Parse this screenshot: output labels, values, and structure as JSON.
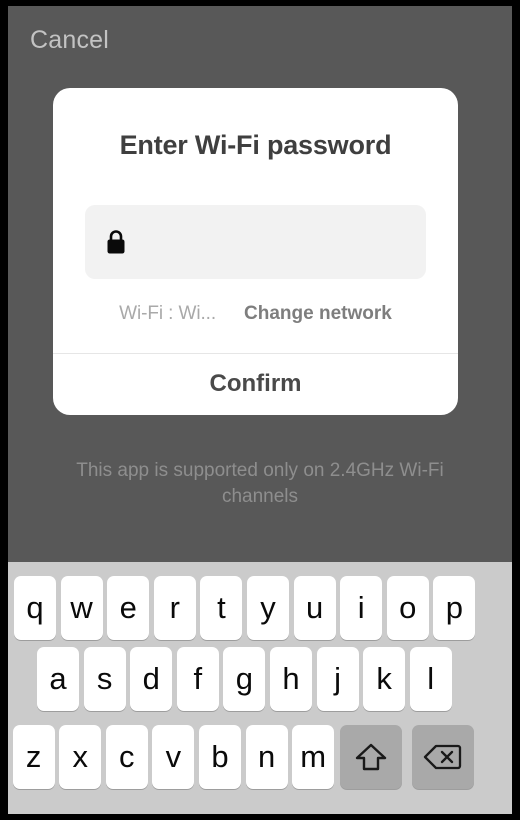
{
  "overlay": {
    "cancel_label": "Cancel"
  },
  "dialog": {
    "title": "Enter Wi-Fi password",
    "password_field": {
      "value": "",
      "placeholder": "",
      "icon": "lock-icon"
    },
    "network_label": "Wi-Fi : Wi...",
    "change_network_label": "Change network",
    "confirm_label": "Confirm"
  },
  "footer": {
    "note": "This app is supported only on 2.4GHz Wi-Fi channels"
  },
  "keyboard": {
    "row1": [
      "q",
      "w",
      "e",
      "r",
      "t",
      "y",
      "u",
      "i",
      "o",
      "p"
    ],
    "row2": [
      "a",
      "s",
      "d",
      "f",
      "g",
      "h",
      "j",
      "k",
      "l"
    ],
    "row3": [
      "z",
      "x",
      "c",
      "v",
      "b",
      "n",
      "m"
    ],
    "shift_icon": "shift-arrow-icon",
    "backspace_icon": "backspace-delete-icon"
  },
  "colors": {
    "scrim": "#585858",
    "card": "#ffffff",
    "field": "#f2f2f2",
    "keyboard_bg": "#cbcbcb",
    "key": "#ffffff",
    "key_modifier": "#a9a9a9",
    "title_text": "#3f3f3f",
    "muted_text": "#a9a9a9",
    "footer_text": "#8e8e8e"
  }
}
